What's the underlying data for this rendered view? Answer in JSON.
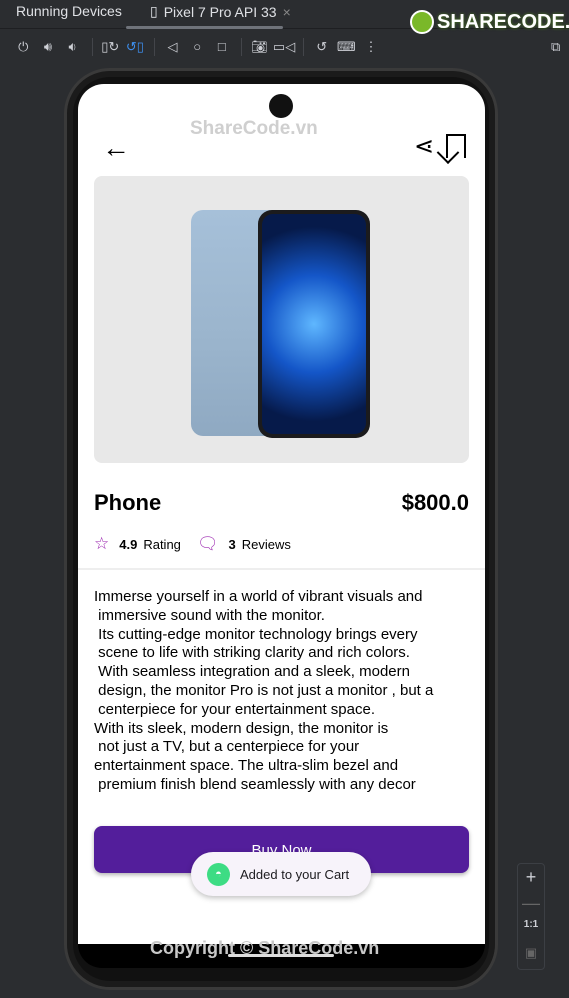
{
  "ide": {
    "tool_window_title": "Running Devices",
    "device_tab": "Pixel 7 Pro API 33",
    "close_glyph": "×",
    "toolbar": [
      "power-icon",
      "volume-up-icon",
      "volume-down-icon",
      "rotate-left-icon",
      "rotate-right-icon",
      "back-icon",
      "home-icon",
      "overview-icon",
      "screenshot-icon",
      "screen-record-icon",
      "reset-icon",
      "keyboard-icon",
      "more-icon",
      "device-mirror-icon"
    ],
    "zoom": {
      "plus": "+",
      "minus": "—",
      "one_to_one": "1:1"
    }
  },
  "watermark": {
    "logo": "SHARECODE.vn",
    "top": "ShareCode.vn",
    "bottom": "Copyright © ShareCode.vn"
  },
  "app": {
    "product": {
      "name": "Phone",
      "price": "$800.0",
      "rating": "4.9",
      "rating_label": "Rating",
      "reviews": "3",
      "reviews_label": "Reviews"
    },
    "description_lines": [
      "Immerse yourself in a world of vibrant visuals and",
      " immersive sound with the monitor.",
      " Its cutting-edge monitor technology brings every",
      " scene to life with striking clarity and rich colors.",
      " With seamless integration and a sleek, modern",
      " design, the monitor Pro is not just a monitor , but a",
      " centerpiece for your entertainment space.",
      "With its sleek, modern design, the monitor is",
      " not just a TV, but a centerpiece for your",
      "entertainment space. The ultra-slim bezel and",
      " premium finish blend seamlessly with any decor"
    ],
    "buy_button": "Buy Now",
    "toast": "Added to your Cart",
    "accent_color": "#531e9b",
    "icon_color": "#9c27b0"
  }
}
